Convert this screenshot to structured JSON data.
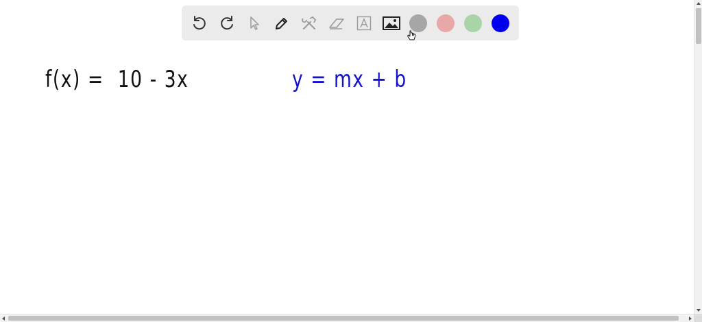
{
  "toolbar": {
    "tools": [
      {
        "name": "undo-icon"
      },
      {
        "name": "redo-icon"
      },
      {
        "name": "select-pointer-icon"
      },
      {
        "name": "pen-icon"
      },
      {
        "name": "tools-icon"
      },
      {
        "name": "eraser-icon"
      },
      {
        "name": "text-box-icon"
      },
      {
        "name": "image-icon"
      }
    ],
    "colors": [
      "#a6a6a6",
      "#e8a8a8",
      "#a8d4a8",
      "#0000ee"
    ]
  },
  "canvas": {
    "equation_left": "f(x) =  10 - 3x",
    "equation_right": "y = mx + b",
    "ink_black": "#111111",
    "ink_blue": "#1212cc"
  }
}
